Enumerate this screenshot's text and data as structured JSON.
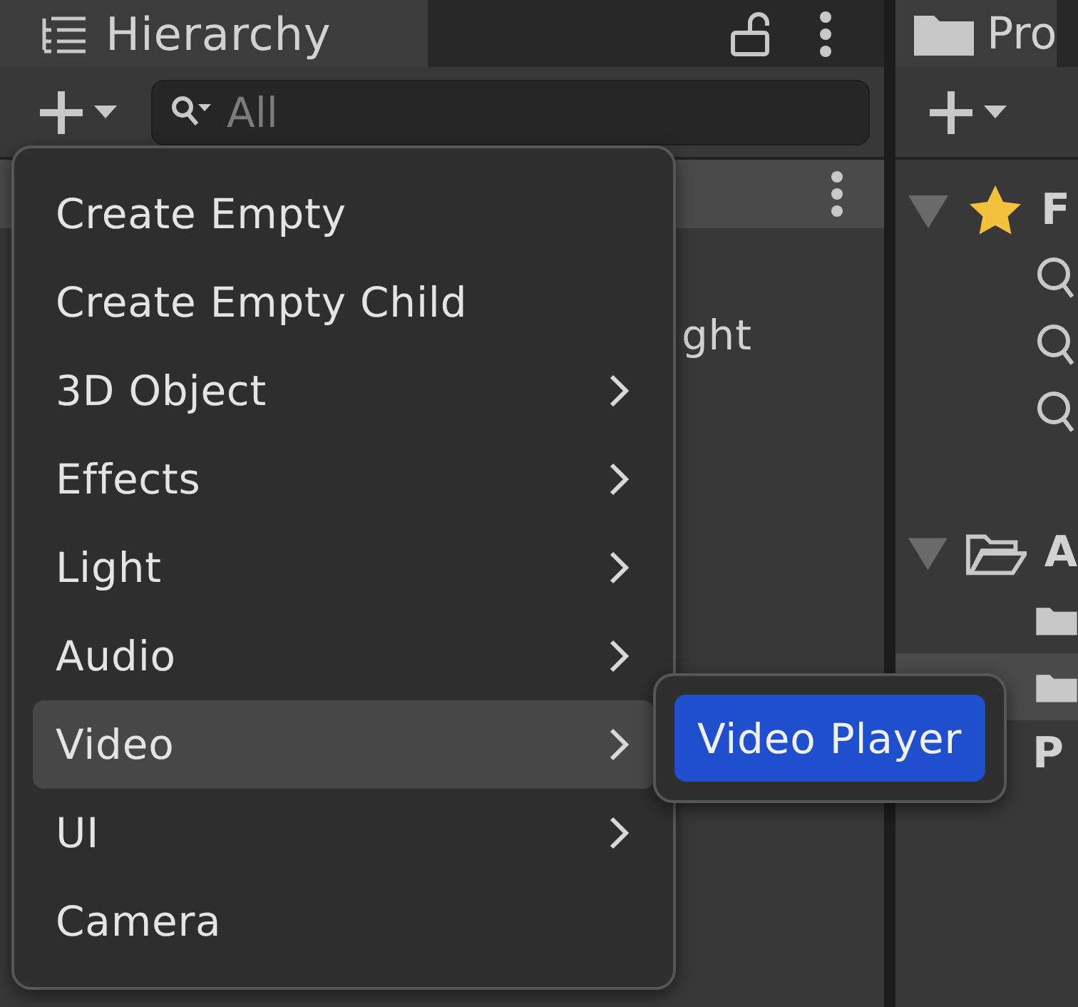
{
  "hierarchy": {
    "tab": {
      "label": "Hierarchy"
    },
    "search": {
      "placeholder": "All"
    },
    "rows": [
      {
        "label": "ght"
      }
    ]
  },
  "context_menu": {
    "items": [
      {
        "label": "Create Empty",
        "submenu": false,
        "selected": false
      },
      {
        "label": "Create Empty Child",
        "submenu": false,
        "selected": false
      },
      {
        "label": "3D Object",
        "submenu": true,
        "selected": false
      },
      {
        "label": "Effects",
        "submenu": true,
        "selected": false
      },
      {
        "label": "Light",
        "submenu": true,
        "selected": false
      },
      {
        "label": "Audio",
        "submenu": true,
        "selected": false
      },
      {
        "label": "Video",
        "submenu": true,
        "selected": true
      },
      {
        "label": "UI",
        "submenu": true,
        "selected": false
      },
      {
        "label": "Camera",
        "submenu": false,
        "selected": false
      }
    ]
  },
  "submenu": {
    "items": [
      {
        "label": "Video Player",
        "selected": true
      }
    ]
  },
  "project": {
    "tab": {
      "label": "Pro"
    },
    "tree": [
      {
        "kind": "favorites",
        "label": "F",
        "expanded": true,
        "children": [
          {
            "kind": "search"
          },
          {
            "kind": "search"
          },
          {
            "kind": "search"
          }
        ]
      },
      {
        "kind": "folder",
        "label": "A",
        "expanded": true,
        "children": [
          {
            "kind": "folder",
            "selected": false
          },
          {
            "kind": "folder",
            "selected": true
          },
          {
            "kind": "text",
            "label": "P",
            "selected": false
          }
        ]
      }
    ]
  }
}
